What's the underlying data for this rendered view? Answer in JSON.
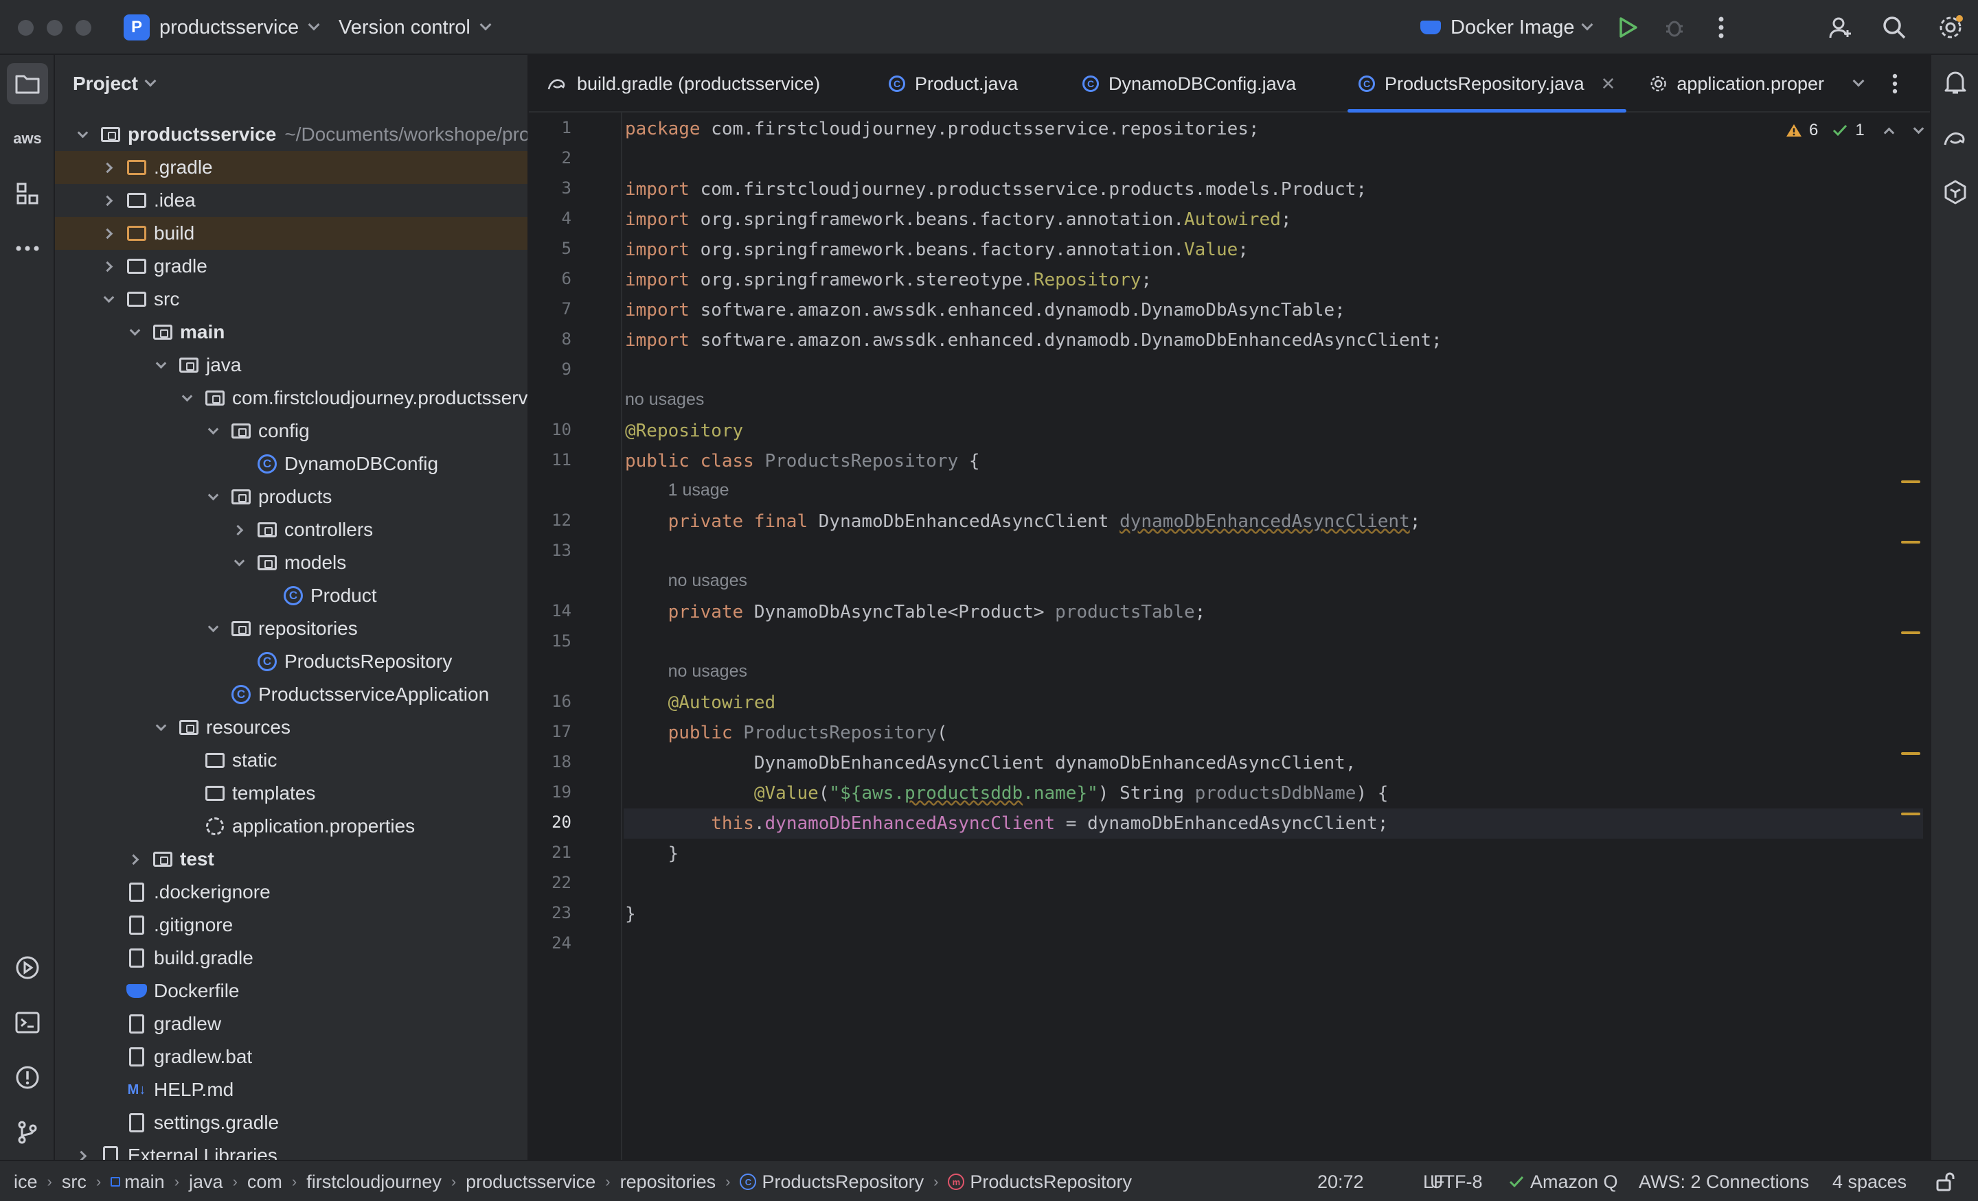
{
  "titlebar": {
    "project_badge": "P",
    "project_name": "productsservice",
    "vcs_label": "Version control",
    "run_config": "Docker Image"
  },
  "project_panel": {
    "title": "Project",
    "tree": [
      {
        "label": "productsservice",
        "path": "~/Documents/workshope/products",
        "icon": "module-folder-icon",
        "arrow": "open",
        "depth": 0,
        "bold": true
      },
      {
        "label": ".gradle",
        "icon": "folder-excluded-icon",
        "arrow": "closed",
        "depth": 1,
        "highlight": true
      },
      {
        "label": ".idea",
        "icon": "folder-icon",
        "arrow": "closed",
        "depth": 1
      },
      {
        "label": "build",
        "icon": "folder-excluded-icon",
        "arrow": "closed",
        "depth": 1,
        "highlight": true
      },
      {
        "label": "gradle",
        "icon": "folder-icon",
        "arrow": "closed",
        "depth": 1
      },
      {
        "label": "src",
        "icon": "folder-icon",
        "arrow": "open",
        "depth": 1
      },
      {
        "label": "main",
        "icon": "module-folder-icon",
        "arrow": "open",
        "depth": 2,
        "bold": true
      },
      {
        "label": "java",
        "icon": "source-folder-icon",
        "arrow": "open",
        "depth": 3
      },
      {
        "label": "com.firstcloudjourney.productsservice",
        "icon": "package-icon",
        "arrow": "open",
        "depth": 4
      },
      {
        "label": "config",
        "icon": "package-icon",
        "arrow": "open",
        "depth": 5
      },
      {
        "label": "DynamoDBConfig",
        "icon": "class-icon",
        "arrow": "none",
        "depth": 6
      },
      {
        "label": "products",
        "icon": "package-icon",
        "arrow": "open",
        "depth": 5
      },
      {
        "label": "controllers",
        "icon": "package-icon",
        "arrow": "closed",
        "depth": 6
      },
      {
        "label": "models",
        "icon": "package-icon",
        "arrow": "open",
        "depth": 6
      },
      {
        "label": "Product",
        "icon": "class-icon",
        "arrow": "none",
        "depth": 7
      },
      {
        "label": "repositories",
        "icon": "package-icon",
        "arrow": "open",
        "depth": 5
      },
      {
        "label": "ProductsRepository",
        "icon": "class-icon",
        "arrow": "none",
        "depth": 6
      },
      {
        "label": "ProductsserviceApplication",
        "icon": "class-icon",
        "arrow": "none",
        "depth": 5
      },
      {
        "label": "resources",
        "icon": "resources-folder-icon",
        "arrow": "open",
        "depth": 3
      },
      {
        "label": "static",
        "icon": "folder-icon",
        "arrow": "none",
        "depth": 4
      },
      {
        "label": "templates",
        "icon": "folder-icon",
        "arrow": "none",
        "depth": 4
      },
      {
        "label": "application.properties",
        "icon": "settings-file-icon",
        "arrow": "none",
        "depth": 4
      },
      {
        "label": "test",
        "icon": "module-folder-icon",
        "arrow": "closed",
        "depth": 2,
        "bold": true
      },
      {
        "label": ".dockerignore",
        "icon": "docker-ignore-icon",
        "arrow": "none",
        "depth": 1
      },
      {
        "label": ".gitignore",
        "icon": "git-ignore-icon",
        "arrow": "none",
        "depth": 1
      },
      {
        "label": "build.gradle",
        "icon": "gradle-icon",
        "arrow": "none",
        "depth": 1
      },
      {
        "label": "Dockerfile",
        "icon": "docker-icon",
        "arrow": "none",
        "depth": 1
      },
      {
        "label": "gradlew",
        "icon": "terminal-file-icon",
        "arrow": "none",
        "depth": 1
      },
      {
        "label": "gradlew.bat",
        "icon": "text-file-icon",
        "arrow": "none",
        "depth": 1
      },
      {
        "label": "HELP.md",
        "icon": "markdown-icon",
        "arrow": "none",
        "depth": 1
      },
      {
        "label": "settings.gradle",
        "icon": "gradle-icon",
        "arrow": "none",
        "depth": 1
      },
      {
        "label": "External Libraries",
        "icon": "library-icon",
        "arrow": "closed",
        "depth": 0
      }
    ]
  },
  "tabs": [
    {
      "label": "build.gradle (productsservice)",
      "icon": "gradle-icon",
      "active": false
    },
    {
      "label": "Product.java",
      "icon": "class-icon",
      "active": false
    },
    {
      "label": "DynamoDBConfig.java",
      "icon": "class-icon",
      "active": false
    },
    {
      "label": "ProductsRepository.java",
      "icon": "class-icon",
      "active": true
    },
    {
      "label": "application.proper",
      "icon": "settings-file-icon",
      "active": false
    }
  ],
  "inspections": {
    "warnings": "6",
    "ok": "1"
  },
  "editor": {
    "current_line": "20",
    "lines": [
      {
        "n": "1",
        "segs": [
          [
            "kw",
            "package "
          ],
          [
            "",
            "com.firstcloudjourney.productsservice.repositories;"
          ]
        ]
      },
      {
        "n": "2",
        "segs": []
      },
      {
        "n": "3",
        "segs": [
          [
            "kw",
            "import "
          ],
          [
            "",
            "com.firstcloudjourney.productsservice.products.models.Product;"
          ]
        ]
      },
      {
        "n": "4",
        "segs": [
          [
            "kw",
            "import "
          ],
          [
            "",
            "org.springframework.beans.factory.annotation."
          ],
          [
            "ann",
            "Autowired"
          ],
          [
            "",
            ";"
          ]
        ]
      },
      {
        "n": "5",
        "segs": [
          [
            "kw",
            "import "
          ],
          [
            "",
            "org.springframework.beans.factory.annotation."
          ],
          [
            "ann",
            "Value"
          ],
          [
            "",
            ";"
          ]
        ]
      },
      {
        "n": "6",
        "segs": [
          [
            "kw",
            "import "
          ],
          [
            "",
            "org.springframework.stereotype."
          ],
          [
            "ann",
            "Repository"
          ],
          [
            "",
            ";"
          ]
        ]
      },
      {
        "n": "7",
        "segs": [
          [
            "kw",
            "import "
          ],
          [
            "",
            "software.amazon.awssdk.enhanced.dynamodb.DynamoDbAsyncTable;"
          ]
        ]
      },
      {
        "n": "8",
        "segs": [
          [
            "kw",
            "import "
          ],
          [
            "",
            "software.amazon.awssdk.enhanced.dynamodb.DynamoDbEnhancedAsyncClient;"
          ]
        ]
      },
      {
        "n": "9",
        "segs": []
      },
      {
        "hint": "no usages",
        "indent": 0
      },
      {
        "n": "10",
        "segs": [
          [
            "ann",
            "@Repository"
          ]
        ]
      },
      {
        "n": "11",
        "segs": [
          [
            "kw",
            "public class "
          ],
          [
            "gray",
            "ProductsRepository"
          ],
          [
            "",
            " {"
          ]
        ]
      },
      {
        "hint": "1 usage",
        "indent": 1
      },
      {
        "n": "12",
        "segs": [
          [
            "",
            "    "
          ],
          [
            "kw",
            "private final "
          ],
          [
            "",
            "DynamoDbEnhancedAsyncClient "
          ],
          [
            "gray uline",
            "dynamoDbEnhancedAsyncClient"
          ],
          [
            "",
            ";"
          ]
        ]
      },
      {
        "n": "13",
        "segs": []
      },
      {
        "hint": "no usages",
        "indent": 1
      },
      {
        "n": "14",
        "segs": [
          [
            "",
            "    "
          ],
          [
            "kw",
            "private "
          ],
          [
            "",
            "DynamoDbAsyncTable<Product> "
          ],
          [
            "gray",
            "productsTable"
          ],
          [
            "",
            ";"
          ]
        ]
      },
      {
        "n": "15",
        "segs": []
      },
      {
        "hint": "no usages",
        "indent": 1
      },
      {
        "n": "16",
        "segs": [
          [
            "",
            "    "
          ],
          [
            "ann",
            "@Autowired"
          ]
        ]
      },
      {
        "n": "17",
        "segs": [
          [
            "",
            "    "
          ],
          [
            "kw",
            "public "
          ],
          [
            "gray",
            "ProductsRepository"
          ],
          [
            "",
            "("
          ]
        ]
      },
      {
        "n": "18",
        "segs": [
          [
            "",
            "            DynamoDbEnhancedAsyncClient dynamoDbEnhancedAsyncClient,"
          ]
        ]
      },
      {
        "n": "19",
        "segs": [
          [
            "",
            "            "
          ],
          [
            "ann",
            "@Value"
          ],
          [
            "",
            "("
          ],
          [
            "str",
            "\"${aws."
          ],
          [
            "str uline",
            "productsddb"
          ],
          [
            "str",
            ".name}\""
          ],
          [
            "",
            ") String "
          ],
          [
            "gray",
            "productsDdbName"
          ],
          [
            "",
            ") {"
          ]
        ]
      },
      {
        "n": "20",
        "segs": [
          [
            "",
            "        "
          ],
          [
            "kw",
            "this"
          ],
          [
            "",
            "."
          ],
          [
            "fld",
            "dynamoDbEnhancedAsyncClient"
          ],
          [
            "",
            " = dynamoDbEnhancedAsyncClient;"
          ]
        ]
      },
      {
        "n": "21",
        "segs": [
          [
            "",
            "    }"
          ]
        ]
      },
      {
        "n": "22",
        "segs": []
      },
      {
        "n": "23",
        "segs": [
          [
            "",
            "}"
          ]
        ]
      },
      {
        "n": "24",
        "segs": []
      }
    ]
  },
  "statusbar": {
    "breadcrumbs": [
      "ice",
      "src",
      "main",
      "java",
      "com",
      "firstcloudjourney",
      "productsservice",
      "repositories",
      "ProductsRepository",
      "ProductsRepository"
    ],
    "position": "20:72",
    "line_sep": "LF",
    "encoding": "UTF-8",
    "amazon_q": "Amazon Q",
    "aws": "AWS: 2 Connections",
    "indent": "4 spaces"
  },
  "colors": {
    "accent": "#3574f0",
    "warning": "#c79a32",
    "keyword": "#cf8e6d",
    "annotation": "#b3ae60"
  }
}
